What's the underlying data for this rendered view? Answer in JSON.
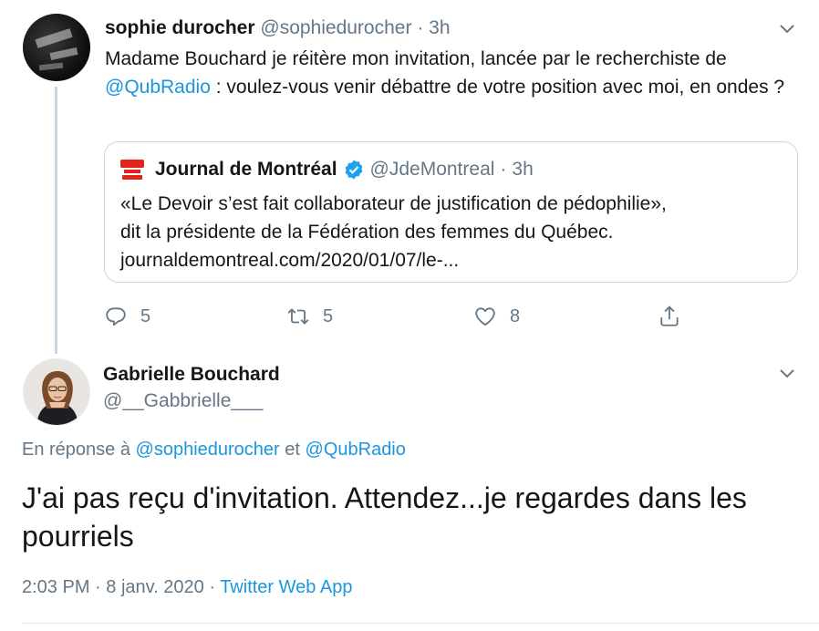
{
  "tweet1": {
    "name": "sophie durocher",
    "handle": "@sophiedurocher",
    "separator": "·",
    "time": "3h",
    "text_before": "Madame Bouchard je réitère mon invitation, lancée par le recherchiste de ",
    "mention": "@QubRadio",
    "text_after": " : voulez-vous venir débattre de votre position avec moi, en ondes ?",
    "quoted": {
      "name": "Journal de Montréal",
      "handle": "@JdeMontreal",
      "separator": "·",
      "time": "3h",
      "text_line1": "«Le Devoir s’est fait collaborateur de justification de pédophilie»,",
      "text_line2": "dit la présidente de la Fédération des femmes du Québec.",
      "text_line3": "journaldemontreal.com/2020/01/07/le-..."
    },
    "actions": {
      "replies": "5",
      "retweets": "5",
      "likes": "8"
    }
  },
  "tweet2": {
    "name": "Gabrielle Bouchard",
    "handle": "@__Gabbrielle___",
    "reply_prefix": "En réponse à ",
    "reply_user1": "@sophiedurocher",
    "reply_and": " et ",
    "reply_user2": "@QubRadio",
    "text": "J'ai pas reçu d'invitation. Attendez...je regardes dans les pourriels",
    "time": "2:03 PM",
    "dot1": " · ",
    "date": "8 janv. 2020",
    "dot2": " · ",
    "source": "Twitter Web App"
  },
  "icons": {
    "chevron": "chevron-down-icon",
    "verified": "verified-badge-icon",
    "reply": "reply-icon",
    "retweet": "retweet-icon",
    "like": "heart-icon",
    "share": "share-icon"
  },
  "colors": {
    "link": "#1b95e0",
    "muted": "#657786",
    "text": "#14171a",
    "border": "#ccd6dd",
    "brand_red": "#e2231a"
  }
}
